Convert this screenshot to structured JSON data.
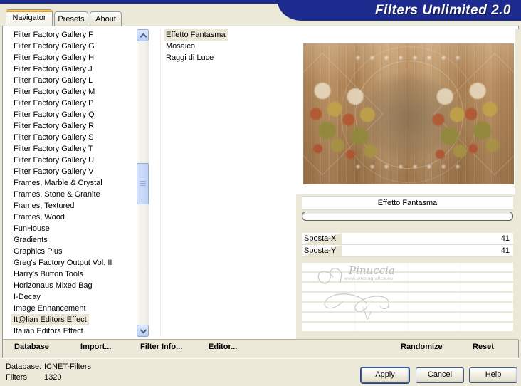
{
  "titlebar": {
    "title": "Filters Unlimited 2.0"
  },
  "tabs": [
    {
      "label": "Navigator",
      "active": true
    },
    {
      "label": "Presets",
      "active": false
    },
    {
      "label": "About",
      "active": false
    }
  ],
  "category_list": {
    "items": [
      {
        "label": "Filter Factory Gallery F"
      },
      {
        "label": "Filter Factory Gallery G"
      },
      {
        "label": "Filter Factory Gallery H"
      },
      {
        "label": "Filter Factory Gallery J"
      },
      {
        "label": "Filter Factory Gallery L"
      },
      {
        "label": "Filter Factory Gallery M"
      },
      {
        "label": "Filter Factory Gallery P"
      },
      {
        "label": "Filter Factory Gallery Q"
      },
      {
        "label": "Filter Factory Gallery R"
      },
      {
        "label": "Filter Factory Gallery S"
      },
      {
        "label": "Filter Factory Gallery T"
      },
      {
        "label": "Filter Factory Gallery U"
      },
      {
        "label": "Filter Factory Gallery V"
      },
      {
        "label": "Frames, Marble & Crystal"
      },
      {
        "label": "Frames, Stone & Granite"
      },
      {
        "label": "Frames, Textured"
      },
      {
        "label": "Frames, Wood"
      },
      {
        "label": "FunHouse"
      },
      {
        "label": "Gradients"
      },
      {
        "label": "Graphics Plus"
      },
      {
        "label": "Greg's Factory Output Vol. II"
      },
      {
        "label": "Harry's Button Tools"
      },
      {
        "label": "Horizonaus Mixed Bag"
      },
      {
        "label": "I-Decay"
      },
      {
        "label": "Image Enhancement"
      },
      {
        "label": "It@lian Editors Effect",
        "selected": true
      },
      {
        "label": "Italian Editors Effect"
      }
    ]
  },
  "filter_list": {
    "items": [
      {
        "label": "Effetto Fantasma",
        "selected": true
      },
      {
        "label": "Mosaico"
      },
      {
        "label": "Raggi di Luce"
      }
    ]
  },
  "preview_panel": {
    "selected_filter_label": "Effetto Fantasma",
    "progress_percent": 0,
    "sliders": [
      {
        "label": "Sposta-X",
        "value": "41",
        "fill_percent": 19
      },
      {
        "label": "Sposta-Y",
        "value": "41",
        "fill_percent": 19
      }
    ]
  },
  "watermark": {
    "name": "Pinuccia",
    "url": "www.ombragrafica.eu"
  },
  "command_bar": {
    "database": {
      "pre": "",
      "accel": "D",
      "post": "atabase"
    },
    "import": {
      "pre": "I",
      "accel": "m",
      "post": "port..."
    },
    "filter_info": {
      "pre": "Filter ",
      "accel": "I",
      "post": "nfo..."
    },
    "editor": {
      "pre": "",
      "accel": "E",
      "post": "ditor..."
    },
    "randomize": {
      "label": "Randomize"
    },
    "reset": {
      "label": "Reset"
    }
  },
  "status": {
    "database_label": "Database:",
    "database_value": "ICNET-Filters",
    "filters_label": "Filters:",
    "filters_value": "1320"
  },
  "action_buttons": {
    "apply": "Apply",
    "cancel": "Cancel",
    "help": "Help"
  },
  "colors": {
    "banner_navy": "#1e2b8e",
    "window_bg": "#ece9d8",
    "selection_bg": "#ebe7d6",
    "active_tab_accent": "#e2902c"
  }
}
